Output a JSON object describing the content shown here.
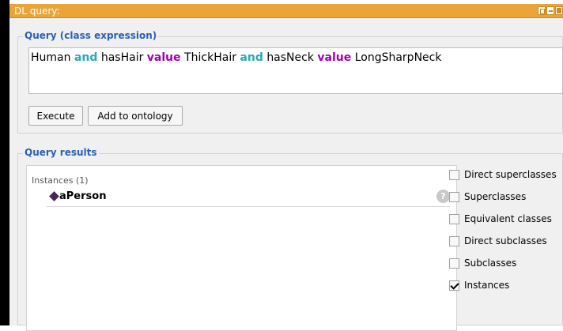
{
  "window": {
    "title": "DL query:"
  },
  "query": {
    "legend": "Query (class expression)",
    "tokens": [
      {
        "text": "Human",
        "kind": "plain"
      },
      {
        "text": "and",
        "kind": "keyword-cyan"
      },
      {
        "text": "hasHair",
        "kind": "plain"
      },
      {
        "text": "value",
        "kind": "keyword-magenta"
      },
      {
        "text": " ThickHair",
        "kind": "plain"
      },
      {
        "text": "and",
        "kind": "keyword-cyan"
      },
      {
        "text": "hasNeck",
        "kind": "plain"
      },
      {
        "text": "value",
        "kind": "keyword-magenta"
      },
      {
        "text": "LongSharpNeck",
        "kind": "plain"
      }
    ],
    "execute_label": "Execute",
    "add_label": "Add to ontology"
  },
  "results": {
    "legend": "Query results",
    "instances_header": "Instances (1)",
    "items": [
      {
        "name": "aPerson",
        "icon": "individual-diamond-icon",
        "help": "?"
      }
    ],
    "options": [
      {
        "label": "Direct superclasses",
        "checked": false
      },
      {
        "label": "Superclasses",
        "checked": false
      },
      {
        "label": "Equivalent classes",
        "checked": false
      },
      {
        "label": "Direct subclasses",
        "checked": false
      },
      {
        "label": "Subclasses",
        "checked": false
      },
      {
        "label": "Instances",
        "checked": true
      }
    ]
  },
  "colors": {
    "titlebar": "#e9a53a",
    "legend": "#2b5fb3",
    "keyword_cyan": "#2aa9b4",
    "keyword_magenta": "#a000b4",
    "individual": "#4a2554"
  }
}
